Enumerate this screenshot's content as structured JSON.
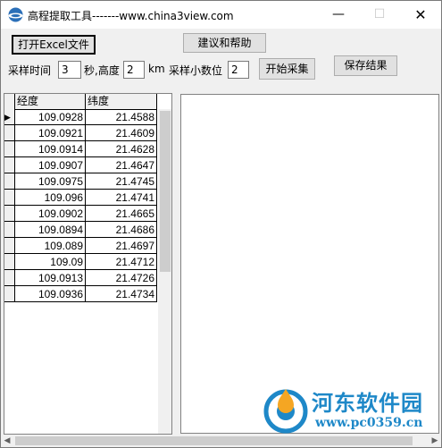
{
  "window": {
    "title": "高程提取工具-------www.china3view.com",
    "minimize_glyph": "—",
    "maximize_glyph": "☐",
    "close_glyph": "✕"
  },
  "toolbar": {
    "open_excel_label": "打开Excel文件",
    "help_label": "建议和帮助",
    "start_label": "开始采集",
    "save_label": "保存结果",
    "interval_label": "采样时间",
    "interval_value": "3",
    "seconds_height_label": "秒,高度",
    "height_value": "2",
    "km_label": "km",
    "decimals_label": "采样小数位",
    "decimals_value": "2"
  },
  "grid": {
    "headers": [
      "经度",
      "纬度"
    ],
    "rows": [
      {
        "lon": "109.0928",
        "lat": "21.4588",
        "current": "▶"
      },
      {
        "lon": "109.0921",
        "lat": "21.4609",
        "current": ""
      },
      {
        "lon": "109.0914",
        "lat": "21.4628",
        "current": ""
      },
      {
        "lon": "109.0907",
        "lat": "21.4647",
        "current": ""
      },
      {
        "lon": "109.0975",
        "lat": "21.4745",
        "current": ""
      },
      {
        "lon": "109.096",
        "lat": "21.4741",
        "current": ""
      },
      {
        "lon": "109.0902",
        "lat": "21.4665",
        "current": ""
      },
      {
        "lon": "109.0894",
        "lat": "21.4686",
        "current": ""
      },
      {
        "lon": "109.089",
        "lat": "21.4697",
        "current": ""
      },
      {
        "lon": "109.09",
        "lat": "21.4712",
        "current": ""
      },
      {
        "lon": "109.0913",
        "lat": "21.4726",
        "current": ""
      },
      {
        "lon": "109.0936",
        "lat": "21.4734",
        "current": ""
      }
    ]
  },
  "scrollbar": {
    "left_arrow": "◀",
    "right_arrow": "▶"
  },
  "watermark": {
    "title": "河东软件园",
    "url": "www.pc0359.cn"
  },
  "colors": {
    "window_bg": "#f0f0f0",
    "watermark_blue": "#1e88c8",
    "logo_orange": "#f5a623"
  }
}
